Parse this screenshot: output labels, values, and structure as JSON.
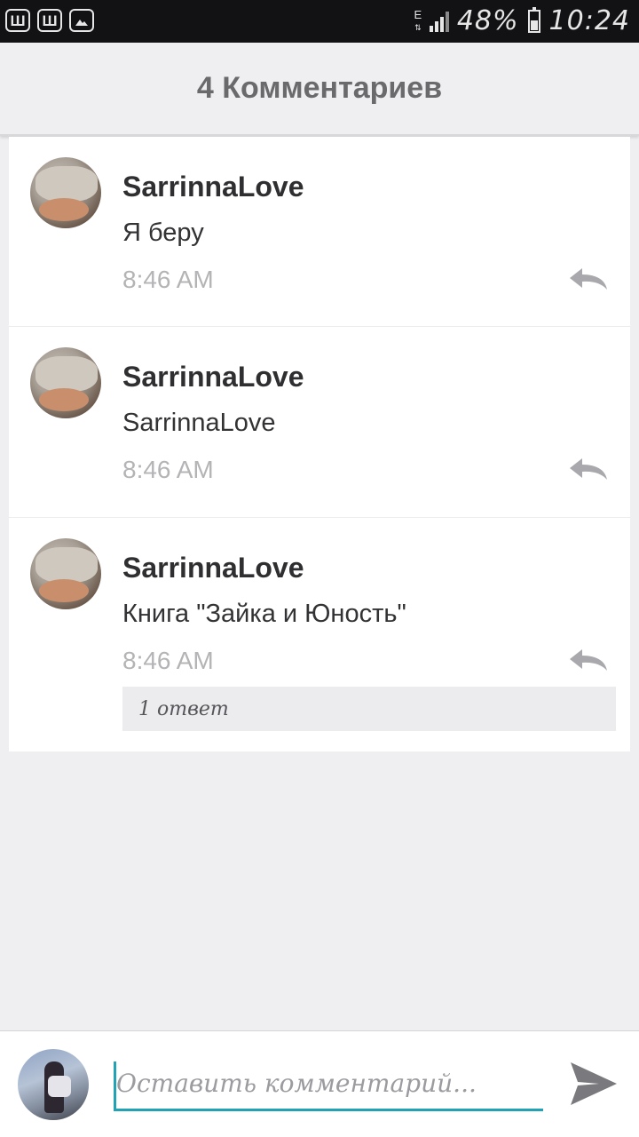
{
  "status_bar": {
    "app_icons": [
      "Ш",
      "Ш"
    ],
    "network_type": "E",
    "battery_percent": "48%",
    "battery_level": 0.48,
    "time": "10:24"
  },
  "header": {
    "title": "4 Комментариев"
  },
  "comments": [
    {
      "author": "SarrinnaLove",
      "text": "Я беру",
      "time": "8:46 AM",
      "reply_icon": "reply-arrow-icon"
    },
    {
      "author": "SarrinnaLove",
      "text": "SarrinnaLove",
      "time": "8:46 AM",
      "reply_icon": "reply-arrow-icon"
    },
    {
      "author": "SarrinnaLove",
      "text": "Книга \"Зайка и Юность\"",
      "time": "8:46 AM",
      "reply_icon": "reply-arrow-icon",
      "replies_label": "1 ответ"
    }
  ],
  "input_bar": {
    "placeholder": "Оставить комментарий...",
    "value": "",
    "send_icon": "send-icon"
  },
  "colors": {
    "accent": "#1fa3b5",
    "background": "#efeef1",
    "card": "#ffffff",
    "muted_text": "#b4b4b6"
  }
}
